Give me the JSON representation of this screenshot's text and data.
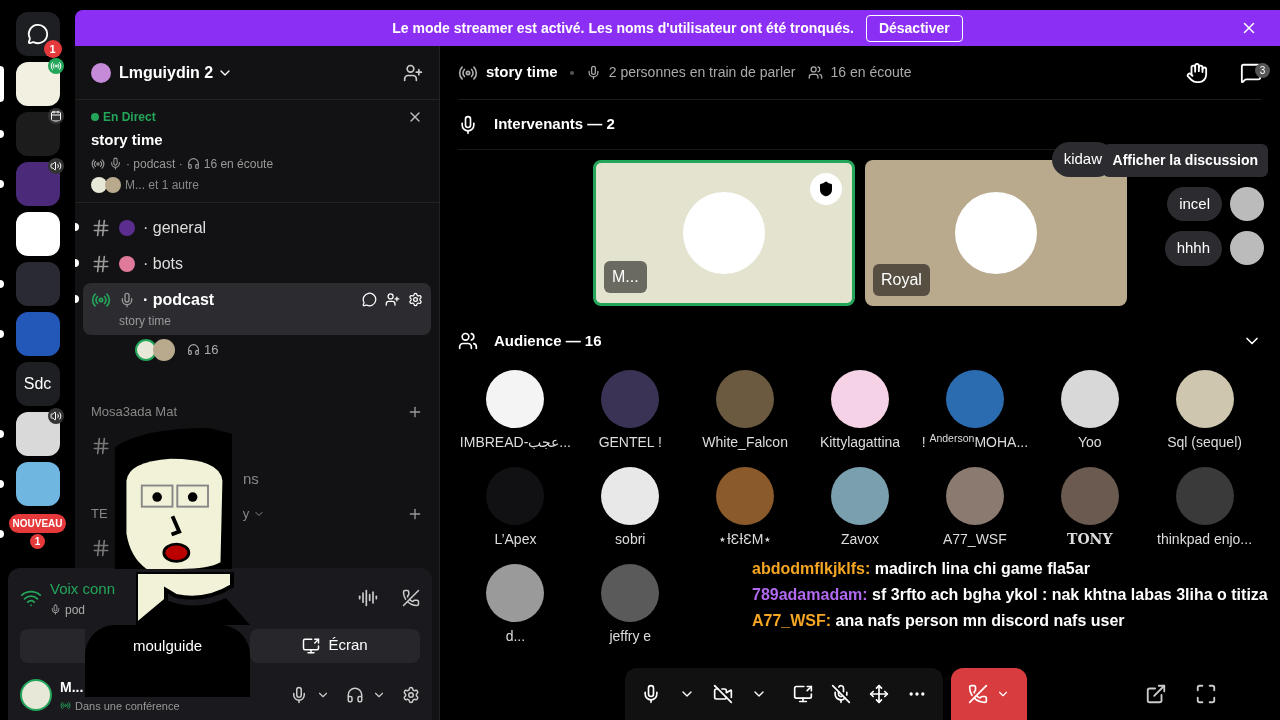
{
  "rail": [
    {
      "kind": "logo",
      "badge": "1",
      "selected": false,
      "unread": false
    },
    {
      "kind": "avatar",
      "color": "#f2f0e0",
      "selected": true,
      "unread": false,
      "in_stage": true
    },
    {
      "kind": "avatar",
      "color": "#1c1c1c",
      "selected": false,
      "unread": true,
      "has_event": true
    },
    {
      "kind": "avatar",
      "color": "#4b2a7a",
      "selected": false,
      "unread": true,
      "in_voice": true
    },
    {
      "kind": "avatar",
      "color": "#ffffff",
      "selected": false,
      "unread": false
    },
    {
      "kind": "avatar",
      "color": "#2a2a33",
      "selected": false,
      "unread": true
    },
    {
      "kind": "avatar",
      "color": "#2458b8",
      "selected": false,
      "unread": true
    },
    {
      "kind": "text",
      "label": "Sdc",
      "selected": false,
      "unread": false
    },
    {
      "kind": "avatar",
      "color": "#d9d9d9",
      "selected": false,
      "unread": true,
      "in_voice": true
    },
    {
      "kind": "avatar",
      "color": "#6fb6e0",
      "selected": false,
      "unread": true
    },
    {
      "kind": "new",
      "label": "NOUVEAU",
      "badge": "1",
      "selected": false,
      "unread": true
    }
  ],
  "banner": {
    "text": "Le mode streamer est activé. Les noms d'utilisateur ont été tronqués.",
    "button": "Désactiver"
  },
  "sidebar": {
    "server_name": "Lmguiydin 2",
    "live": {
      "status": "En Direct",
      "title": "story time",
      "channel": "· podcast ·",
      "listeners": "16 en écoute",
      "participants": "M... et 1 autre"
    },
    "channels": [
      {
        "kind": "text",
        "name": "· general",
        "color": "#5b2d8e",
        "selected": false,
        "unread": true
      },
      {
        "kind": "text",
        "name": "· bots",
        "color": "#e07a9a",
        "selected": false,
        "unread": true
      },
      {
        "kind": "stage",
        "name": "· podcast",
        "subtitle": "story time",
        "selected": true,
        "unread": true,
        "listeners": "16"
      }
    ],
    "more": [
      {
        "kind": "category",
        "name": "Mosa3ada Mat"
      },
      {
        "kind": "channel"
      },
      {
        "kind": "channel",
        "name": "ns"
      },
      {
        "kind": "category",
        "name": "TE",
        "trail": "y"
      },
      {
        "kind": "channel"
      }
    ],
    "voice": {
      "status": "Voix conn",
      "channel": "pod",
      "screen": "Écran"
    },
    "user": {
      "name": "M...",
      "status": "Dans une conférence"
    }
  },
  "overlay": {
    "label": "moulguide"
  },
  "stage": {
    "title": "story time",
    "speakers": "2 personnes en train de parler",
    "listeners": "16 en écoute",
    "chat_badge": "3",
    "tooltip": "Afficher la discussion",
    "speakers_title": "Intervenants — 2",
    "speaker_cards": [
      {
        "name": "M...",
        "speaking": true,
        "moderator": true,
        "color": "#e3e3d0"
      },
      {
        "name": "Royal",
        "speaking": false,
        "moderator": false,
        "color": "#b9aa8d"
      }
    ],
    "pills": [
      {
        "name": "kidaw",
        "avatar": false
      },
      {
        "name": "incel",
        "avatar": true
      },
      {
        "name": "hhhh",
        "avatar": true
      }
    ],
    "audience_title": "Audience — 16",
    "audience_expanded": true,
    "audience": [
      "IMBREAD-عجب...",
      "GENTEL !",
      "White_Falcon",
      "Kittylagattina",
      "! $^{Anderson}$MOHA...",
      "Yoo",
      "Sql (sequel)",
      "L’Apex",
      "sobri",
      "⋆ƗƐƗƐM⋆",
      "Zavox",
      "A77_WSF",
      "TONY",
      "thinkpad enjo...",
      "d...",
      "jeffry e"
    ]
  },
  "chat": [
    {
      "user": "abdodmflkjklfs:",
      "color": "#f5a623",
      "text": "madirch lina chi game fla5ar"
    },
    {
      "user": "789adamadam:",
      "color": "#b069f0",
      "text": "sf 3rfto ach bgha ykol : nak khtna labas 3liha o titiza"
    },
    {
      "user": "A77_WSF:",
      "color": "#f5a623",
      "text": "ana nafs person mn discord nafs user"
    }
  ]
}
